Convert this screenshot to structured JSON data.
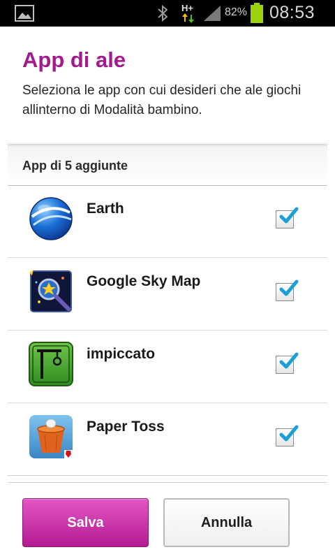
{
  "status_bar": {
    "battery_percent": "82%",
    "time": "08:53",
    "network_label": "H+",
    "icons": [
      "gallery-icon",
      "bluetooth-icon",
      "hplus-data-icon",
      "signal-icon",
      "battery-icon"
    ],
    "battery_color": "#9dd10c"
  },
  "page": {
    "title": "App di ale",
    "description": "Seleziona le app con cui desideri che ale giochi allinterno di Modalità bambino."
  },
  "section": {
    "header": "App di 5 aggiunte"
  },
  "apps": [
    {
      "name": "Earth",
      "icon": "earth-icon",
      "checked": true
    },
    {
      "name": "Google Sky Map",
      "icon": "sky-map-icon",
      "checked": true
    },
    {
      "name": "impiccato",
      "icon": "hangman-icon",
      "checked": true
    },
    {
      "name": "Paper Toss",
      "icon": "paper-toss-icon",
      "checked": true
    }
  ],
  "buttons": {
    "save": "Salva",
    "cancel": "Annulla"
  },
  "colors": {
    "accent": "#a31a8f",
    "check": "#1aa0d8"
  }
}
